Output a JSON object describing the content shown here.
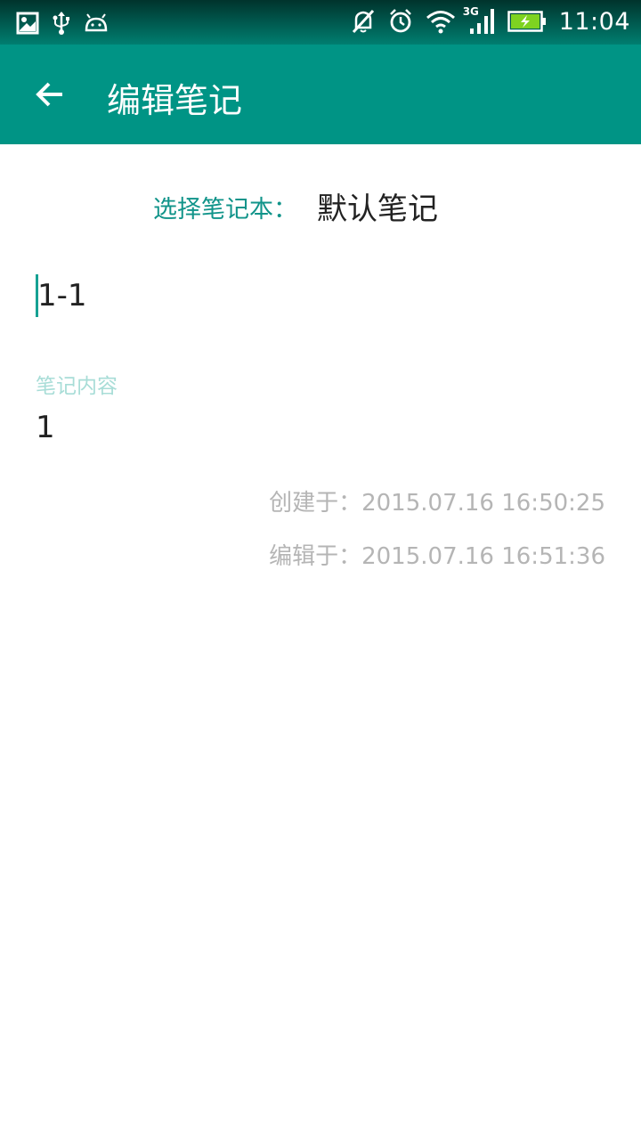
{
  "status_bar": {
    "time": "11:04",
    "network": "3G",
    "left_icons": [
      "image-icon",
      "usb-icon",
      "android-icon"
    ],
    "right_icons": [
      "mute-icon",
      "alarm-icon",
      "wifi-icon",
      "signal-icon",
      "battery-charging-icon"
    ]
  },
  "app_bar": {
    "title": "编辑笔记",
    "back_icon": "arrow-left-icon",
    "color": "#009485"
  },
  "notebook": {
    "label": "选择笔记本：",
    "value": "默认笔记"
  },
  "note": {
    "title": "1-1",
    "content_hint": "笔记内容",
    "content": "1"
  },
  "meta": {
    "created": "创建于：2015.07.16 16:50:25",
    "edited": "编辑于：2015.07.16 16:51:36"
  },
  "colors": {
    "accent": "#11948a",
    "hint": "#a8ddd7",
    "meta": "#b5b5b5"
  }
}
